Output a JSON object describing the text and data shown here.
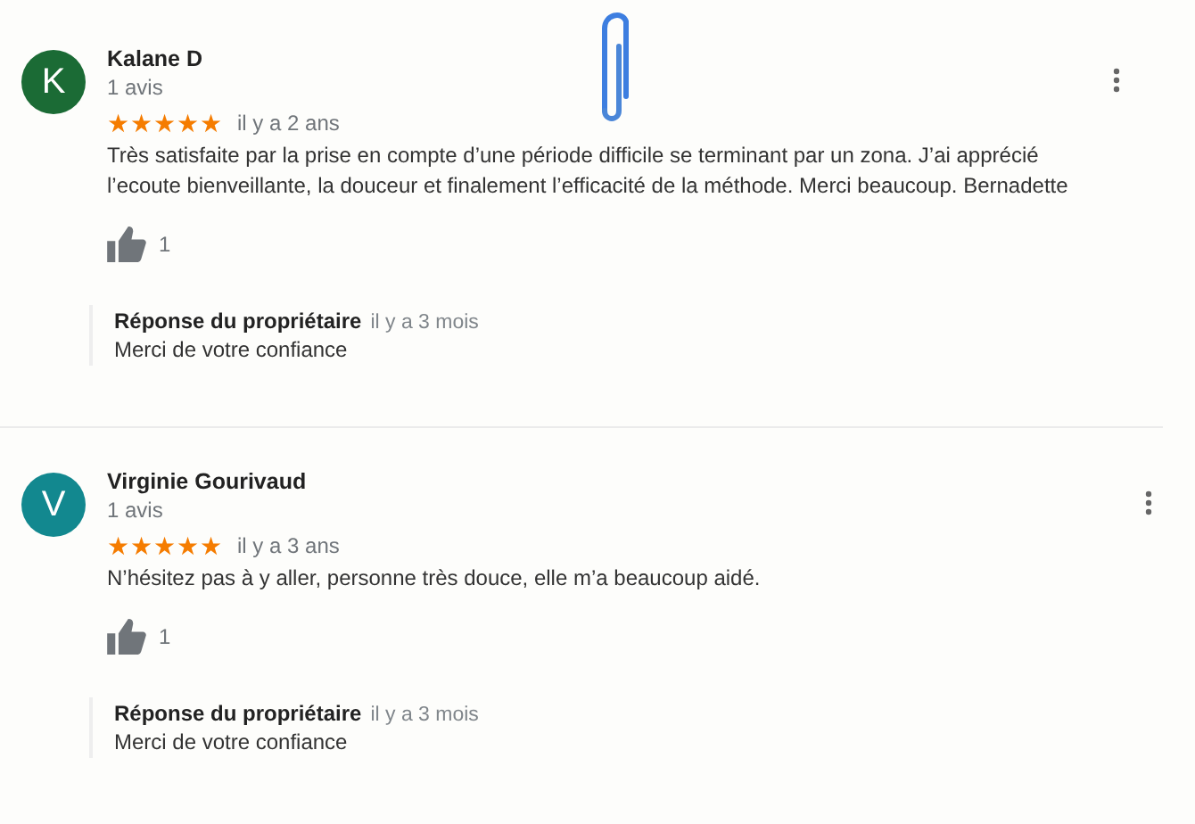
{
  "reviews": [
    {
      "initial": "K",
      "color": "#1b6b35",
      "name": "Kalane D",
      "count": "1 avis",
      "stars": 5,
      "time": "il y a 2 ans",
      "text": "Très satisfaite par la prise en compte d’une période difficile se terminant par un zona. J’ai apprécié l’ecoute bienveillante, la douceur et finalement l’efficacité de la méthode. Merci beaucoup. Bernadette",
      "likes": "1",
      "reply": {
        "label": "Réponse du propriétaire",
        "time": "il y a 3 mois",
        "text": "Merci de votre confiance"
      }
    },
    {
      "initial": "V",
      "color": "#12888f",
      "name": "Virginie Gourivaud",
      "count": "1 avis",
      "stars": 5,
      "time": "il y a 3 ans",
      "text": "N’hésitez pas à y aller, personne très douce, elle m’a beaucoup aidé.",
      "likes": "1",
      "reply": {
        "label": "Réponse du propriétaire",
        "time": "il y a 3 mois",
        "text": "Merci de votre confiance"
      }
    }
  ]
}
